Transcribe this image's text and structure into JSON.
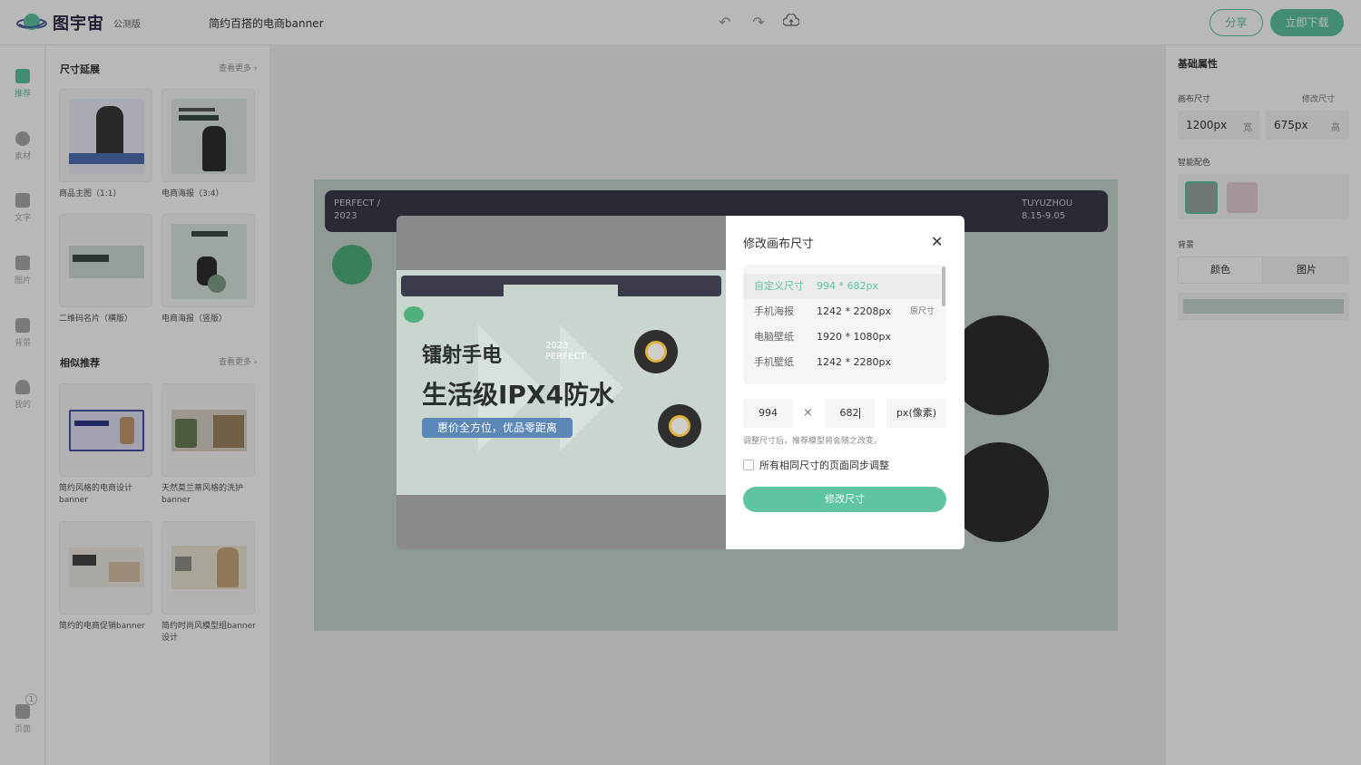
{
  "app": {
    "name": "图宇宙",
    "badge": "公测版",
    "doc_title": "简约百搭的电商banner"
  },
  "toolbar": {
    "share": "分享",
    "download": "立即下载"
  },
  "rail": [
    {
      "label": "推荐",
      "icon": "recommend-icon"
    },
    {
      "label": "素材",
      "icon": "shapes-icon"
    },
    {
      "label": "文字",
      "icon": "text-icon"
    },
    {
      "label": "图片",
      "icon": "image-icon"
    },
    {
      "label": "背景",
      "icon": "background-icon"
    },
    {
      "label": "我的",
      "icon": "user-icon"
    }
  ],
  "pages": {
    "label": "页面",
    "count": "1"
  },
  "left_panel": {
    "section1": {
      "title": "尺寸延展",
      "more": "查看更多"
    },
    "section1_items": [
      "商品主图（1:1）",
      "电商海报（3:4）",
      "二维码名片（横版）",
      "电商海报（竖版）"
    ],
    "section2": {
      "title": "相似推荐",
      "more": "查看更多"
    },
    "section2_items": [
      "简约风格的电商设计banner",
      "天然莫兰蒂风格的洗护banner",
      "简约的电商促销banner",
      "简约时尚风模型组banner设计"
    ]
  },
  "canvas": {
    "top_left_line1": "PERFECT /",
    "top_left_line2": "2023",
    "top_right_line1": "TUYUZHOU",
    "top_right_line2": "8.15-9.05",
    "title_line1": "镭射手电",
    "title_line2": "生活级IPX4防水",
    "year": "2023",
    "perfect": "PERFECT",
    "tagline": "惠价全方位，优品零距离"
  },
  "right_panel": {
    "title": "基础属性",
    "canvas_size_label": "画布尺寸",
    "edit_size_link": "修改尺寸",
    "width_value": "1200px",
    "width_unit": "宽",
    "height_value": "675px",
    "height_unit": "高",
    "smart_color_label": "智能配色",
    "background_label": "背景",
    "bg_tabs": [
      "颜色",
      "图片"
    ],
    "colors": {
      "swatch1": "#9aa59f",
      "swatch2": "#e3cdd9",
      "accent": "#5ec4a3"
    }
  },
  "modal": {
    "title": "修改画布尺寸",
    "presets": [
      {
        "name": "自定义尺寸",
        "size": "994 * 682px",
        "tag": ""
      },
      {
        "name": "手机海报",
        "size": "1242 * 2208px",
        "tag": "原尺寸"
      },
      {
        "name": "电脑壁纸",
        "size": "1920 * 1080px",
        "tag": ""
      },
      {
        "name": "手机壁纸",
        "size": "1242 * 2280px",
        "tag": ""
      }
    ],
    "width_input": "994",
    "times": "×",
    "height_input": "682",
    "unit": "px(像素)",
    "hint": "调整尺寸后，推荐模型将会随之改变。",
    "sync_label": "所有相同尺寸的页面同步调整",
    "submit": "修改尺寸"
  }
}
